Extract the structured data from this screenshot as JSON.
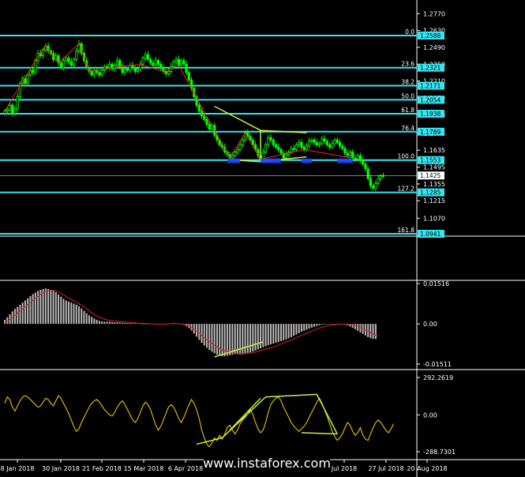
{
  "colors": {
    "background": "#000000",
    "axis": "#ffffff",
    "fib_line": "#33e6f0",
    "candle_up": "#00ff00",
    "candle_down": "#00ff00",
    "zigzag": "#ff2020",
    "annotation": "#c8f03c",
    "support_box": "#2040ff",
    "hist": "#b8b8b8",
    "signal": "#e02020",
    "oscillator": "#ffd700",
    "price_box": "#ffffff"
  },
  "price_axis": {
    "ticks": [
      "1.2770",
      "1.2630",
      "1.2490",
      "1.2350",
      "1.2210",
      "1.2070",
      "1.1930",
      "1.1775",
      "1.1635",
      "1.1495",
      "1.1355",
      "1.1215",
      "1.1070"
    ]
  },
  "current_price": "1.1425",
  "fib_levels": [
    {
      "ratio": "0.0",
      "price": "1.2588"
    },
    {
      "ratio": "23.6",
      "price": "1.2321"
    },
    {
      "ratio": "38.2",
      "price": "1.2171"
    },
    {
      "ratio": "50.0",
      "price": "1.2054"
    },
    {
      "ratio": "61.8",
      "price": "1.1938"
    },
    {
      "ratio": "76.4",
      "price": "1.1789"
    },
    {
      "ratio": "100.0",
      "price": "1.1553"
    },
    {
      "ratio": "127.2",
      "price": "1.1285"
    },
    {
      "ratio": "161.8",
      "price": "1.0941"
    }
  ],
  "date_axis": [
    "8 Jan 2018",
    "30 Jan 2018",
    "21 Feb 2018",
    "15 Mar 2018",
    "6 Apr 2018",
    "",
    "",
    "Jul 2018",
    "27 Jul 2018",
    "20 Aug 2018"
  ],
  "watermark": "www.instaforex.com",
  "macd_axis": [
    "0.01516",
    "0.00",
    "-0.01511"
  ],
  "cci_axis": [
    "292.2619",
    "0.00",
    "-288.7301"
  ],
  "chart_data": [
    {
      "type": "candlestick",
      "title": "",
      "ylim": [
        1.0941,
        1.277
      ],
      "x_range": [
        0,
        158
      ],
      "close": [
        1.196,
        1.197,
        1.201,
        1.194,
        1.198,
        1.208,
        1.219,
        1.223,
        1.219,
        1.226,
        1.23,
        1.228,
        1.238,
        1.244,
        1.242,
        1.247,
        1.25,
        1.246,
        1.244,
        1.239,
        1.242,
        1.236,
        1.232,
        1.238,
        1.24,
        1.237,
        1.234,
        1.239,
        1.246,
        1.252,
        1.244,
        1.238,
        1.232,
        1.229,
        1.226,
        1.23,
        1.228,
        1.226,
        1.23,
        1.233,
        1.232,
        1.235,
        1.231,
        1.234,
        1.238,
        1.233,
        1.228,
        1.231,
        1.23,
        1.234,
        1.232,
        1.229,
        1.231,
        1.235,
        1.24,
        1.243,
        1.239,
        1.236,
        1.234,
        1.238,
        1.235,
        1.232,
        1.229,
        1.227,
        1.229,
        1.233,
        1.237,
        1.239,
        1.234,
        1.238,
        1.235,
        1.228,
        1.222,
        1.215,
        1.208,
        1.201,
        1.196,
        1.192,
        1.189,
        1.185,
        1.181,
        1.184,
        1.176,
        1.172,
        1.168,
        1.166,
        1.162,
        1.16,
        1.157,
        1.159,
        1.162,
        1.164,
        1.168,
        1.172,
        1.178,
        1.175,
        1.172,
        1.168,
        1.164,
        1.159,
        1.156,
        1.162,
        1.168,
        1.174,
        1.172,
        1.168,
        1.166,
        1.164,
        1.161,
        1.157,
        1.16,
        1.162,
        1.165,
        1.164,
        1.168,
        1.17,
        1.166,
        1.164,
        1.167,
        1.171,
        1.172,
        1.17,
        1.168,
        1.169,
        1.173,
        1.171,
        1.168,
        1.166,
        1.169,
        1.172,
        1.17,
        1.167,
        1.165,
        1.161,
        1.159,
        1.162,
        1.157,
        1.156,
        1.159,
        1.155,
        1.152,
        1.148,
        1.14,
        1.134,
        1.132,
        1.136,
        1.14,
        1.142,
        1.1425
      ]
    },
    {
      "type": "bar",
      "title": "",
      "ylim": [
        -0.01511,
        0.01516
      ],
      "histogram": [
        0.0015,
        0.0025,
        0.0036,
        0.0047,
        0.0056,
        0.0064,
        0.0072,
        0.008,
        0.0088,
        0.0096,
        0.0104,
        0.0112,
        0.0118,
        0.0124,
        0.0128,
        0.0131,
        0.0133,
        0.0131,
        0.0128,
        0.0124,
        0.0119,
        0.011,
        0.0102,
        0.0094,
        0.0088,
        0.0084,
        0.008,
        0.0076,
        0.0072,
        0.0066,
        0.0058,
        0.0049,
        0.004,
        0.0032,
        0.0026,
        0.002,
        0.0015,
        0.0011,
        0.0009,
        0.0008,
        0.0008,
        0.0008,
        0.0007,
        0.0006,
        0.0006,
        0.0005,
        0.0004,
        0.0004,
        0.0003,
        0.0003,
        0.0002,
        0.0002,
        0.0001,
        0.0001,
        0.0,
        0.0,
        0.0,
        -0.0001,
        -0.0001,
        -0.0002,
        -0.0002,
        -0.0002,
        -0.0001,
        0.0,
        0.0001,
        0.0002,
        0.0003,
        0.0002,
        0.0001,
        -0.0001,
        -0.0004,
        -0.0009,
        -0.0016,
        -0.0025,
        -0.0036,
        -0.0048,
        -0.006,
        -0.0071,
        -0.0081,
        -0.009,
        -0.0098,
        -0.0105,
        -0.0111,
        -0.0116,
        -0.012,
        -0.0122,
        -0.0122,
        -0.012,
        -0.0118,
        -0.0116,
        -0.0114,
        -0.0113,
        -0.0112,
        -0.0111,
        -0.011,
        -0.0109,
        -0.0107,
        -0.0104,
        -0.01,
        -0.0096,
        -0.0092,
        -0.0088,
        -0.0084,
        -0.008,
        -0.0077,
        -0.0074,
        -0.0071,
        -0.0068,
        -0.0065,
        -0.0062,
        -0.0058,
        -0.0054,
        -0.005,
        -0.0045,
        -0.004,
        -0.0035,
        -0.003,
        -0.0026,
        -0.0022,
        -0.0018,
        -0.0014,
        -0.0011,
        -0.0008,
        -0.0005,
        -0.0003,
        -0.0002,
        -0.0001,
        0.0,
        0.0,
        0.0,
        0.0,
        0.0,
        -0.0001,
        -0.0003,
        -0.0006,
        -0.001,
        -0.0015,
        -0.002,
        -0.0026,
        -0.0032,
        -0.0038,
        -0.0044,
        -0.005,
        -0.0054,
        -0.0056,
        -0.0057
      ],
      "signal": [
        0.0005,
        0.001,
        0.0016,
        0.0024,
        0.0032,
        0.004,
        0.0048,
        0.0056,
        0.0064,
        0.0072,
        0.008,
        0.0088,
        0.0096,
        0.0103,
        0.011,
        0.0116,
        0.0121,
        0.0124,
        0.0126,
        0.0126,
        0.0124,
        0.012,
        0.0115,
        0.0109,
        0.0103,
        0.0097,
        0.0091,
        0.0086,
        0.0081,
        0.0076,
        0.007,
        0.0063,
        0.0056,
        0.0049,
        0.0042,
        0.0036,
        0.003,
        0.0025,
        0.0021,
        0.0018,
        0.0015,
        0.0013,
        0.0012,
        0.0011,
        0.001,
        0.0009,
        0.0008,
        0.0007,
        0.0006,
        0.0005,
        0.0005,
        0.0004,
        0.0003,
        0.0002,
        0.0002,
        0.0001,
        0.0001,
        0.0,
        0.0,
        -0.0001,
        -0.0001,
        -0.0001,
        -0.0001,
        -0.0001,
        0.0,
        0.0001,
        0.0001,
        0.0001,
        0.0001,
        0.0,
        -0.0002,
        -0.0005,
        -0.0009,
        -0.0014,
        -0.002,
        -0.0027,
        -0.0035,
        -0.0043,
        -0.0051,
        -0.0059,
        -0.0066,
        -0.0073,
        -0.008,
        -0.0086,
        -0.0092,
        -0.0097,
        -0.0101,
        -0.0105,
        -0.0108,
        -0.011,
        -0.0112,
        -0.0113,
        -0.0114,
        -0.0113,
        -0.0112,
        -0.0111,
        -0.011,
        -0.0108,
        -0.0106,
        -0.0104,
        -0.0101,
        -0.0098,
        -0.0095,
        -0.0092,
        -0.0089,
        -0.0086,
        -0.0083,
        -0.008,
        -0.0076,
        -0.0072,
        -0.0068,
        -0.0064,
        -0.006,
        -0.0056,
        -0.0052,
        -0.0047,
        -0.0043,
        -0.0039,
        -0.0035,
        -0.0031,
        -0.0027,
        -0.0023,
        -0.002,
        -0.0016,
        -0.0013,
        -0.001,
        -0.0008,
        -0.0006,
        -0.0004,
        -0.0003,
        -0.0002,
        -0.0001,
        -0.0001,
        -0.0001,
        -0.0002,
        -0.0003,
        -0.0005,
        -0.0007,
        -0.001,
        -0.0014,
        -0.0018,
        -0.0023,
        -0.0028,
        -0.0033,
        -0.0038,
        -0.0042,
        -0.0045
      ]
    },
    {
      "type": "line",
      "title": "",
      "ylim": [
        -288.7301,
        292.2619
      ],
      "values": [
        90,
        140,
        120,
        60,
        30,
        70,
        110,
        140,
        150,
        140,
        120,
        100,
        80,
        60,
        70,
        100,
        130,
        120,
        90,
        70,
        110,
        150,
        130,
        90,
        50,
        10,
        -40,
        -90,
        -130,
        -110,
        -60,
        -20,
        20,
        60,
        90,
        110,
        120,
        100,
        70,
        40,
        20,
        0,
        -10,
        20,
        60,
        90,
        110,
        80,
        40,
        0,
        -40,
        -60,
        -30,
        20,
        70,
        100,
        80,
        40,
        -20,
        -80,
        -120,
        -90,
        -40,
        10,
        60,
        80,
        60,
        20,
        -30,
        -60,
        -20,
        30,
        80,
        120,
        90,
        40,
        -30,
        -120,
        -180,
        -230,
        -250,
        -220,
        -180,
        -200,
        -160,
        -190,
        -150,
        -100,
        -80,
        -120,
        -150,
        -120,
        -70,
        -40,
        -20,
        10,
        40,
        0,
        -60,
        -110,
        -140,
        -120,
        -60,
        20,
        80,
        110,
        130,
        140,
        110,
        60,
        20,
        -20,
        -60,
        -90,
        -110,
        -130,
        -110,
        -90,
        -60,
        -20,
        20,
        60,
        100,
        130,
        90,
        40,
        -10,
        -70,
        -130,
        -170,
        -200,
        -180,
        -150,
        -100,
        -60,
        -80,
        -130,
        -160,
        -140,
        -100,
        -160,
        -190,
        -200,
        -150,
        -100,
        -60,
        -40,
        -60,
        -90,
        -120,
        -140,
        -110,
        -70
      ]
    }
  ]
}
